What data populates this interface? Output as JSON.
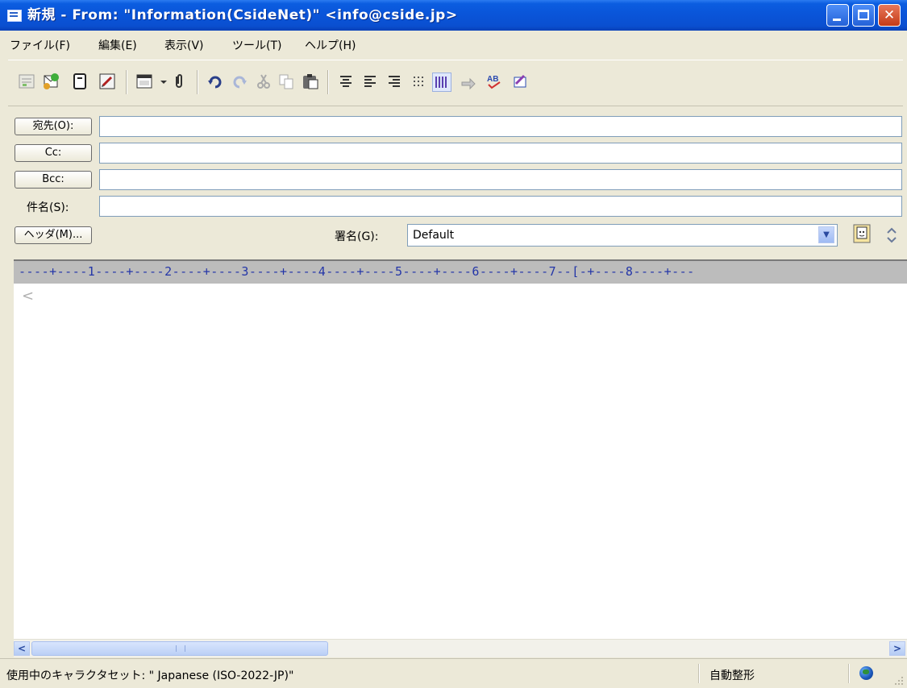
{
  "window": {
    "title": "新規 - From: \"Information(CsideNet)\" <info@cside.jp>",
    "controls": {
      "minimize": "",
      "maximize": "",
      "close": "✕"
    }
  },
  "menu": {
    "items": [
      "ファイル(F)",
      "編集(E)",
      "表示(V)",
      "ツール(T)",
      "ヘルプ(H)"
    ]
  },
  "toolbar": {
    "icons": [
      "send-later-icon",
      "send-icon",
      "address-book-icon",
      "edit-icon",
      "view-icon",
      "attach-icon",
      "undo-icon",
      "redo-icon",
      "cut-icon",
      "copy-icon",
      "paste-icon",
      "align-center-icon",
      "align-left-icon",
      "align-right-icon",
      "list-icon",
      "wrap-icon",
      "quote-icon",
      "spellcheck-icon",
      "sign-icon"
    ]
  },
  "header": {
    "to_label": "宛先(O):",
    "cc_label": "Cc:",
    "bcc_label": "Bcc:",
    "subject_label": "件名(S):",
    "header_button": "ヘッダ(M)...",
    "signature_label": "署名(G):",
    "signature_value": "Default",
    "to_value": "",
    "cc_value": "",
    "bcc_value": "",
    "subject_value": ""
  },
  "ruler": {
    "text": "----+----1----+----2----+----3----+----4----+----5----+----6----+----7--[-+----8----+---"
  },
  "body": {
    "caret": "<"
  },
  "statusbar": {
    "charset": "使用中のキャラクタセット: \" Japanese (ISO-2022-JP)\"",
    "wrap": "自動整形"
  }
}
